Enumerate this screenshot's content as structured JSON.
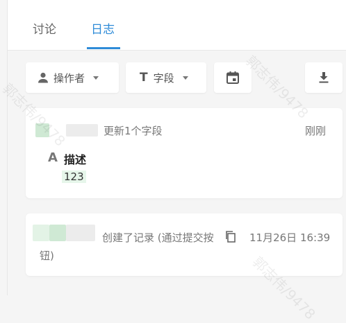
{
  "tabs": [
    {
      "label": "讨论"
    },
    {
      "label": "日志"
    }
  ],
  "toolbar": {
    "operator_label": "操作者",
    "field_label": "字段",
    "field_icon": "T",
    "date_icon": "calendar-icon",
    "download_icon": "download-icon"
  },
  "logs": [
    {
      "summary": "更新1个字段",
      "time": "刚刚",
      "field_icon": "A",
      "field_name": "描述",
      "field_value": "123"
    },
    {
      "summary_line1": "创建了记录 (通过提交按",
      "summary_line2": "钮)",
      "time": "11月26日 16:39"
    }
  ],
  "watermark": "郭志伟/9478"
}
